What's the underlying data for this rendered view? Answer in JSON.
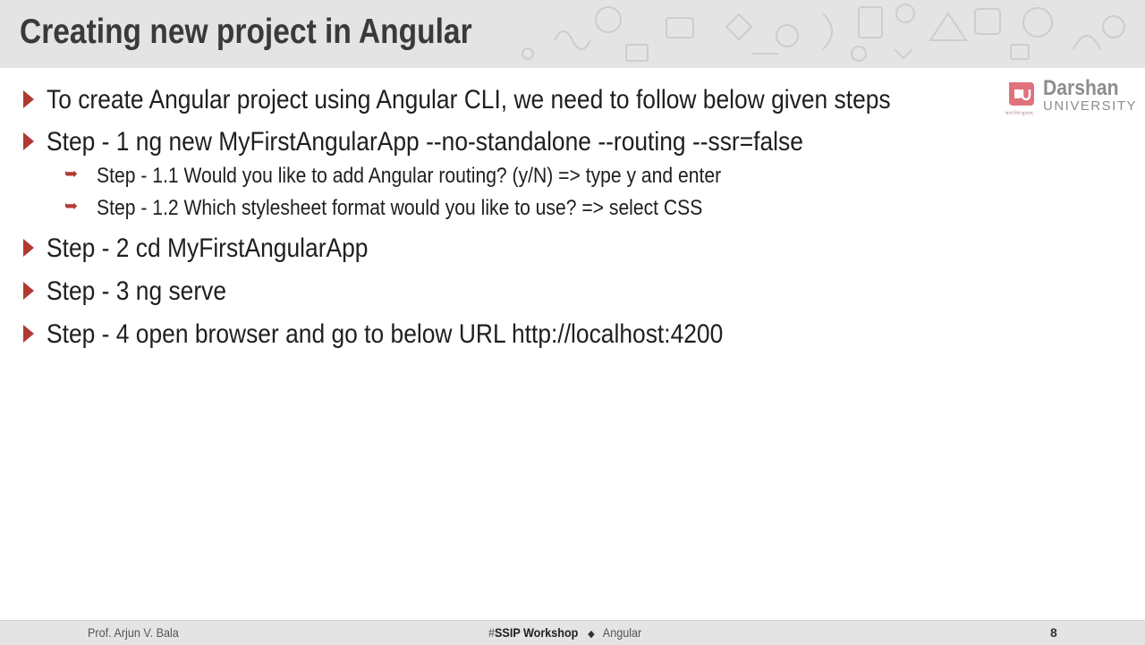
{
  "slide": {
    "title": "Creating new project in Angular"
  },
  "logo": {
    "name": "Darshan",
    "subtitle": "UNIVERSITY",
    "tagline": "सत्यं शिवं सुन्दरम्"
  },
  "bullets": [
    {
      "text": "To create Angular project using Angular CLI, we need to follow below given steps"
    },
    {
      "text": "Step - 1 ng new MyFirstAngularApp --no-standalone --routing --ssr=false",
      "sub": [
        "Step - 1.1 Would you like to add Angular routing? (y/N) => type y and enter",
        "Step - 1.2 Which stylesheet format would you like to use? => select CSS"
      ]
    },
    {
      "text": "Step - 2 cd MyFirstAngularApp"
    },
    {
      "text": "Step - 3 ng serve"
    },
    {
      "text": "Step - 4 open browser and go to below URL http://localhost:4200"
    }
  ],
  "footer": {
    "author": "Prof. Arjun V. Bala",
    "hash": "#",
    "event": "SSIP Workshop",
    "separator": "◆",
    "topic": "Angular",
    "page": "8"
  },
  "colors": {
    "accent": "#b03a32",
    "header_bg": "#e4e4e4",
    "title_text": "#3a3a3a",
    "logo_mark": "#e0727e"
  },
  "icons": {
    "bullet": "triangle-right",
    "sub_bullet": "curved-arrow-right",
    "logo": "du-mark"
  }
}
